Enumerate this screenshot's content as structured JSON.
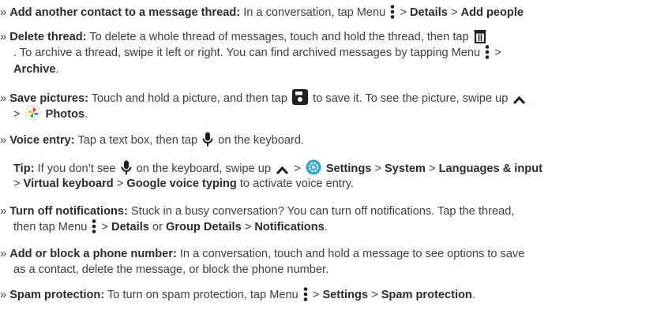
{
  "items": [
    {
      "title": "Add another contact to a message thread:",
      "l1_text": "In a conversation, tap Menu",
      "l1_a": "Details",
      "l1_b": "Add people"
    },
    {
      "title": "Delete thread:",
      "l1_text": "To delete a whole thread of messages, touch and hold the thread, then tap",
      "l2_text": ". To archive a thread, swipe it left or right. You can find archived messages by tapping Menu",
      "l3_bold": "Archive"
    },
    {
      "title": "Save pictures:",
      "l1_text1": "Touch and hold a picture, and then tap",
      "l1_text2": "to save it. To see the picture, swipe up",
      "l2_bold": "Photos"
    },
    {
      "title": "Voice entry:",
      "l1_text1": "Tap a text box, then tap",
      "l1_text2": "on the keyboard."
    }
  ],
  "tip": {
    "label": "Tip:",
    "text1": "If you don’t see",
    "text2": "on the keyboard, swipe up",
    "settings": "Settings",
    "system": "System",
    "languages": "Languages & input",
    "virtual_keyboard": "Virtual keyboard",
    "google_voice": "Google voice typing",
    "tail": "to activate voice entry."
  },
  "items2": [
    {
      "title": "Turn off notifications:",
      "l1_text": "Stuck in a busy conversation? You can turn off notifications. Tap the thread,",
      "l2_text": "then tap Menu",
      "l2_a": "Details",
      "l2_or": "or",
      "l2_b": "Group Details",
      "l2_c": "Notifications"
    },
    {
      "title": "Add or block a phone number:",
      "l1_text": "In a conversation, touch and hold a message to see options to save",
      "l2_text": "as a contact, delete the message, or block the phone number."
    },
    {
      "title": "Spam protection:",
      "l1_text": "To turn on spam protection, tap Menu",
      "l1_a": "Settings",
      "l1_b": "Spam protection"
    }
  ],
  "symbols": {
    "bullet": "»",
    "sep": ">"
  },
  "colors": {
    "text": "#3d3d3d",
    "bold": "#2b2b2b",
    "icon": "#1f1f1f",
    "settings_icon": "#27a6c9"
  },
  "icons": [
    "menu-dots-icon",
    "trash-icon",
    "save-icon",
    "chevron-up-icon",
    "photos-icon",
    "microphone-icon",
    "settings-icon"
  ]
}
